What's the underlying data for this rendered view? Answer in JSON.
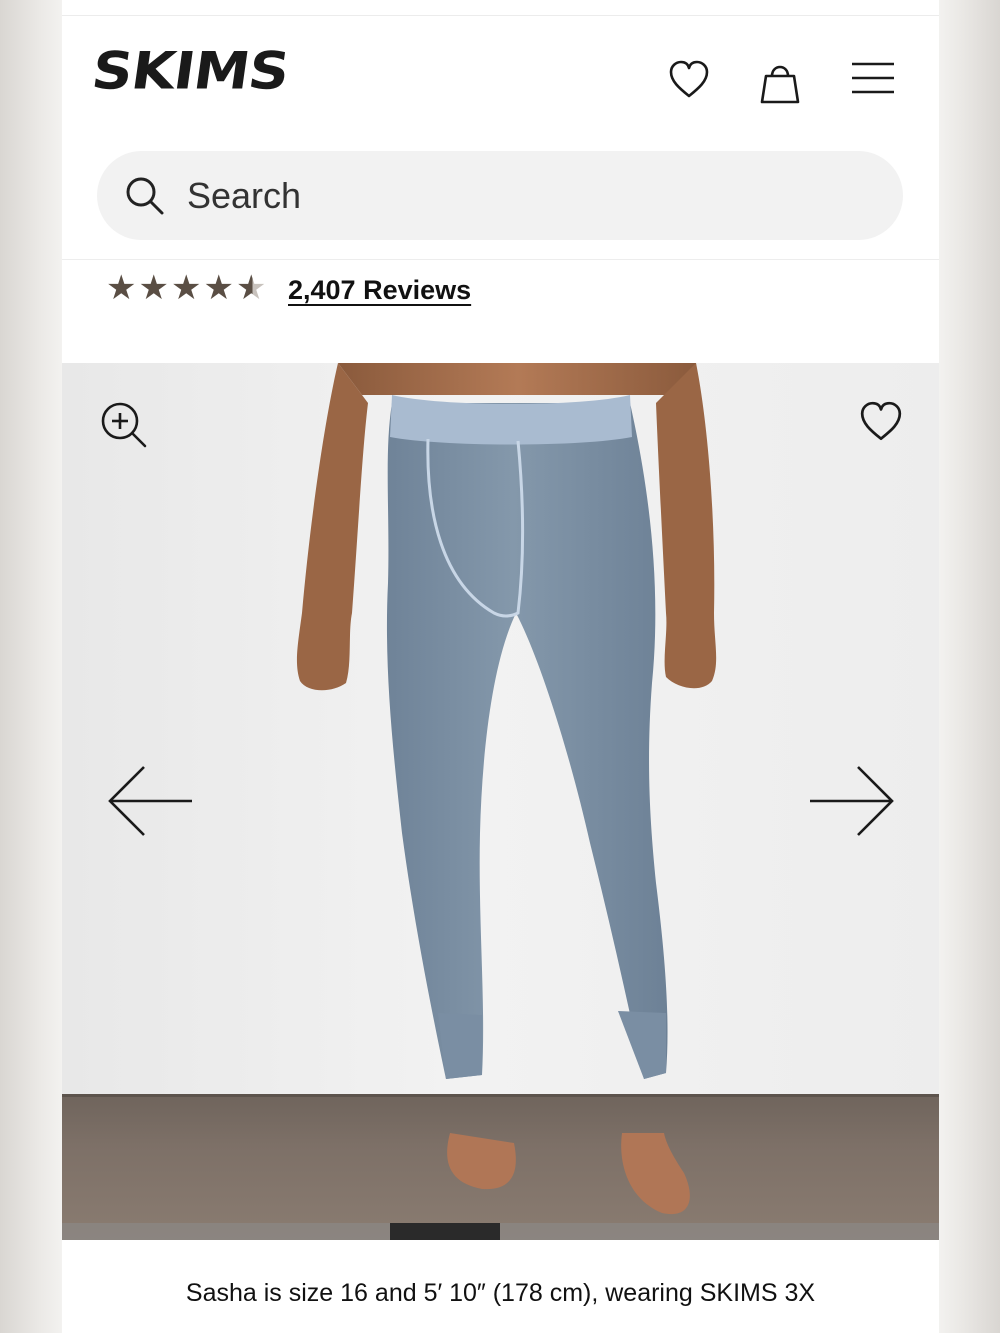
{
  "header": {
    "brand": "SKIMS",
    "icons": {
      "wishlist": "heart-icon",
      "bag": "shopping-bag-icon",
      "menu": "hamburger-menu-icon"
    }
  },
  "search": {
    "placeholder": "Search",
    "icon": "search-icon"
  },
  "rating": {
    "value": 4.5,
    "max": 5,
    "reviews_label": "2,407 Reviews",
    "star_color": "#5a4e44"
  },
  "gallery": {
    "icons": {
      "zoom": "zoom-in-icon",
      "favorite": "heart-icon",
      "prev": "arrow-left-icon",
      "next": "arrow-right-icon"
    },
    "leggings_color": "#7f93a7",
    "progress": 0.125
  },
  "caption": "Sasha is size 16 and 5′ 10″ (178 cm), wearing SKIMS 3X"
}
